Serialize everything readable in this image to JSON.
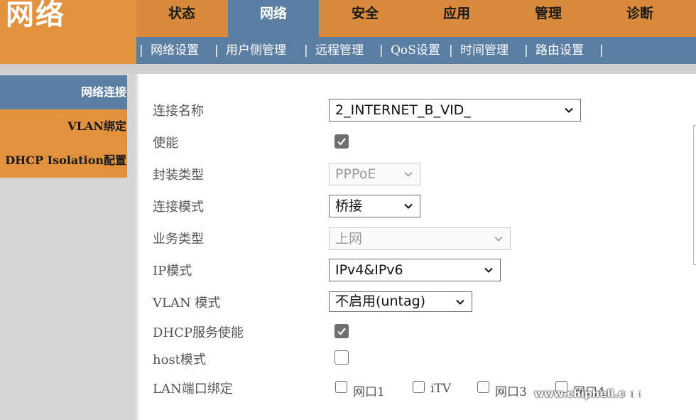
{
  "header": {
    "section_title": "网络",
    "tabs": [
      {
        "label": "状态"
      },
      {
        "label": "网络"
      },
      {
        "label": "安全"
      },
      {
        "label": "应用"
      },
      {
        "label": "管理"
      },
      {
        "label": "诊断"
      }
    ],
    "active_tab": 1
  },
  "subnav": {
    "items": [
      {
        "label": "网络设置"
      },
      {
        "label": "用户侧管理"
      },
      {
        "label": "远程管理"
      },
      {
        "label": "QoS设置"
      },
      {
        "label": "时间管理"
      },
      {
        "label": "路由设置"
      }
    ],
    "separator": "|"
  },
  "sidebar": {
    "items": [
      {
        "label": "网络连接"
      },
      {
        "label": "VLAN绑定"
      },
      {
        "label": "DHCP Isolation配置"
      }
    ],
    "active_index": 0
  },
  "form": {
    "connection_name": {
      "label": "连接名称",
      "value": "2_INTERNET_B_VID_"
    },
    "enable": {
      "label": "使能",
      "checked": true
    },
    "encapsulation": {
      "label": "封装类型",
      "value": "PPPoE",
      "disabled": true
    },
    "connection_mode": {
      "label": "连接模式",
      "value": "桥接"
    },
    "service_type": {
      "label": "业务类型",
      "value": "上网",
      "disabled": true
    },
    "ip_mode": {
      "label": "IP模式",
      "value": "IPv4&IPv6"
    },
    "vlan_mode": {
      "label": "VLAN 模式",
      "value": "不启用(untag)"
    },
    "dhcp_service": {
      "label": "DHCP服务使能",
      "checked": true
    },
    "host_mode": {
      "label": "host模式",
      "checked": false
    },
    "lan_binding": {
      "label": "LAN端口绑定",
      "ports": [
        {
          "label": "网口1",
          "checked": false
        },
        {
          "label": "iTV",
          "checked": false
        },
        {
          "label": "网口3",
          "checked": false
        },
        {
          "label": "网口4",
          "checked": false
        }
      ]
    }
  },
  "watermark": {
    "url": "www.chiphell.com",
    "logo_text": "chip hell"
  },
  "colors": {
    "accent_orange": "#e4913e",
    "accent_blue": "#5b7ea3",
    "sidebar_grey": "#d6d6d6"
  }
}
